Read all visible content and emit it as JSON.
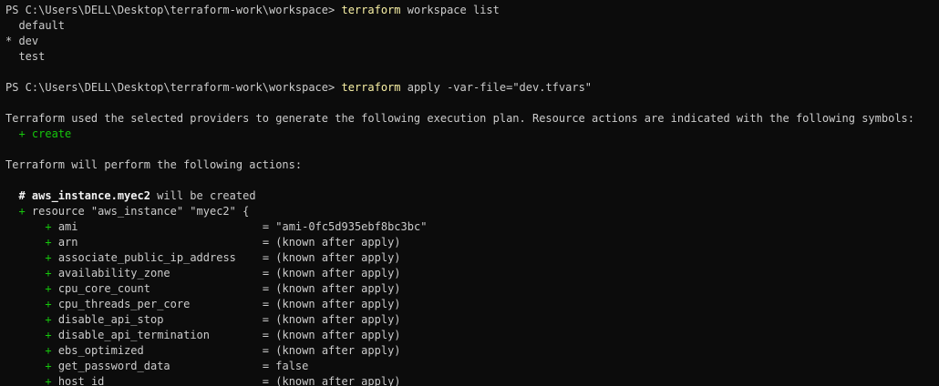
{
  "colors": {
    "background": "#0c0c0c",
    "text": "#cccccc",
    "command": "#f9f1a5",
    "plus": "#16c60c"
  },
  "terminal": {
    "prompt": "PS C:\\Users\\DELL\\Desktop\\terraform-work\\workspace> ",
    "cmd1": {
      "name": "terraform",
      "args": " workspace list"
    },
    "workspaces": [
      "  default",
      "* dev",
      "  test"
    ],
    "cmd2": {
      "name": "terraform",
      "args": " apply -var-file=\"dev.tfvars\""
    },
    "plan_intro": "Terraform used the selected providers to generate the following execution plan. Resource actions are indicated with the following symbols:",
    "create_symbol": "+",
    "create_label": " create",
    "perform_text": "Terraform will perform the following actions:",
    "resource_comment": {
      "hash": "# ",
      "address": "aws_instance.myec2",
      "suffix": " will be created"
    },
    "resource_header": {
      "plus": "+",
      "text": " resource \"aws_instance\" \"myec2\" {"
    },
    "attributes": [
      {
        "name": "ami",
        "value": "= \"ami-0fc5d935ebf8bc3bc\""
      },
      {
        "name": "arn",
        "value": "= (known after apply)"
      },
      {
        "name": "associate_public_ip_address",
        "value": "= (known after apply)"
      },
      {
        "name": "availability_zone",
        "value": "= (known after apply)"
      },
      {
        "name": "cpu_core_count",
        "value": "= (known after apply)"
      },
      {
        "name": "cpu_threads_per_core",
        "value": "= (known after apply)"
      },
      {
        "name": "disable_api_stop",
        "value": "= (known after apply)"
      },
      {
        "name": "disable_api_termination",
        "value": "= (known after apply)"
      },
      {
        "name": "ebs_optimized",
        "value": "= (known after apply)"
      },
      {
        "name": "get_password_data",
        "value": "= false"
      },
      {
        "name": "host_id",
        "value": "= (known after apply)"
      }
    ]
  }
}
